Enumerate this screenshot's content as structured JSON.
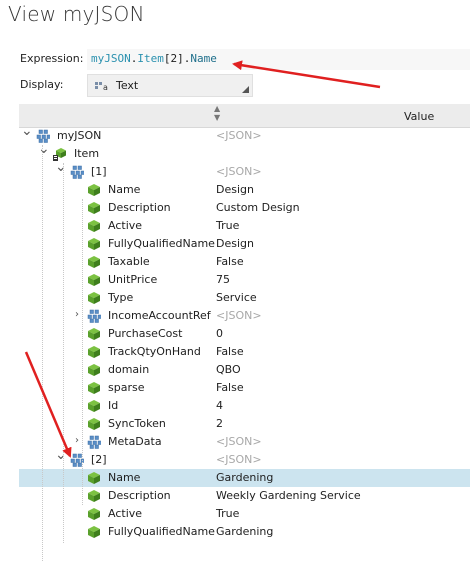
{
  "window": {
    "title": "View myJSON"
  },
  "expression": {
    "label": "Expression:",
    "tokens": [
      {
        "text": "myJSON",
        "kind": "obj"
      },
      {
        "text": ".",
        "kind": "dot"
      },
      {
        "text": "Item",
        "kind": "obj"
      },
      {
        "text": "[2]",
        "kind": "dot"
      },
      {
        "text": ".",
        "kind": "dot"
      },
      {
        "text": "Name",
        "kind": "prop"
      }
    ]
  },
  "display": {
    "label": "Display:",
    "selected": "Text",
    "icon": "text-format-icon"
  },
  "grid": {
    "value_header": "Value",
    "sort_icon": "sort-icon"
  },
  "rows": [
    {
      "indent": 0,
      "expander": "down",
      "icon": "blue-cube-icon",
      "name": "myJSON",
      "value": "<JSON>",
      "json": true
    },
    {
      "indent": 1,
      "expander": "down",
      "icon": "green-cube-list-icon",
      "name": "Item",
      "value": "",
      "json": false
    },
    {
      "indent": 2,
      "expander": "down",
      "icon": "blue-cube-icon",
      "name": "[1]",
      "value": "<JSON>",
      "json": true
    },
    {
      "indent": 3,
      "expander": "",
      "icon": "green-cube-icon",
      "name": "Name",
      "value": "Design",
      "json": false
    },
    {
      "indent": 3,
      "expander": "",
      "icon": "green-cube-icon",
      "name": "Description",
      "value": "Custom Design",
      "json": false
    },
    {
      "indent": 3,
      "expander": "",
      "icon": "green-cube-icon",
      "name": "Active",
      "value": "True",
      "json": false
    },
    {
      "indent": 3,
      "expander": "",
      "icon": "green-cube-icon",
      "name": "FullyQualifiedName",
      "value": "Design",
      "json": false
    },
    {
      "indent": 3,
      "expander": "",
      "icon": "green-cube-icon",
      "name": "Taxable",
      "value": "False",
      "json": false
    },
    {
      "indent": 3,
      "expander": "",
      "icon": "green-cube-icon",
      "name": "UnitPrice",
      "value": "75",
      "json": false
    },
    {
      "indent": 3,
      "expander": "",
      "icon": "green-cube-icon",
      "name": "Type",
      "value": "Service",
      "json": false
    },
    {
      "indent": 3,
      "expander": "right",
      "icon": "blue-cube-icon",
      "name": "IncomeAccountRef",
      "value": "<JSON>",
      "json": true
    },
    {
      "indent": 3,
      "expander": "",
      "icon": "green-cube-icon",
      "name": "PurchaseCost",
      "value": "0",
      "json": false
    },
    {
      "indent": 3,
      "expander": "",
      "icon": "green-cube-icon",
      "name": "TrackQtyOnHand",
      "value": "False",
      "json": false
    },
    {
      "indent": 3,
      "expander": "",
      "icon": "green-cube-icon",
      "name": "domain",
      "value": "QBO",
      "json": false
    },
    {
      "indent": 3,
      "expander": "",
      "icon": "green-cube-icon",
      "name": "sparse",
      "value": "False",
      "json": false
    },
    {
      "indent": 3,
      "expander": "",
      "icon": "green-cube-icon",
      "name": "Id",
      "value": "4",
      "json": false
    },
    {
      "indent": 3,
      "expander": "",
      "icon": "green-cube-icon",
      "name": "SyncToken",
      "value": "2",
      "json": false
    },
    {
      "indent": 3,
      "expander": "right",
      "icon": "blue-cube-icon",
      "name": "MetaData",
      "value": "<JSON>",
      "json": true
    },
    {
      "indent": 2,
      "expander": "down",
      "icon": "blue-cube-icon",
      "name": "[2]",
      "value": "<JSON>",
      "json": true
    },
    {
      "indent": 3,
      "expander": "",
      "icon": "green-cube-icon",
      "name": "Name",
      "value": "Gardening",
      "json": false,
      "selected": true
    },
    {
      "indent": 3,
      "expander": "",
      "icon": "green-cube-icon",
      "name": "Description",
      "value": "Weekly Gardening Service",
      "json": false
    },
    {
      "indent": 3,
      "expander": "",
      "icon": "green-cube-icon",
      "name": "Active",
      "value": "True",
      "json": false
    },
    {
      "indent": 3,
      "expander": "",
      "icon": "green-cube-icon",
      "name": "FullyQualifiedName",
      "value": "Gardening",
      "json": false
    }
  ],
  "colors": {
    "accent": "#2b91af",
    "selection": "#cce4ef",
    "annotation_arrow": "#e02020",
    "muted_json": "#a8a8a8"
  }
}
